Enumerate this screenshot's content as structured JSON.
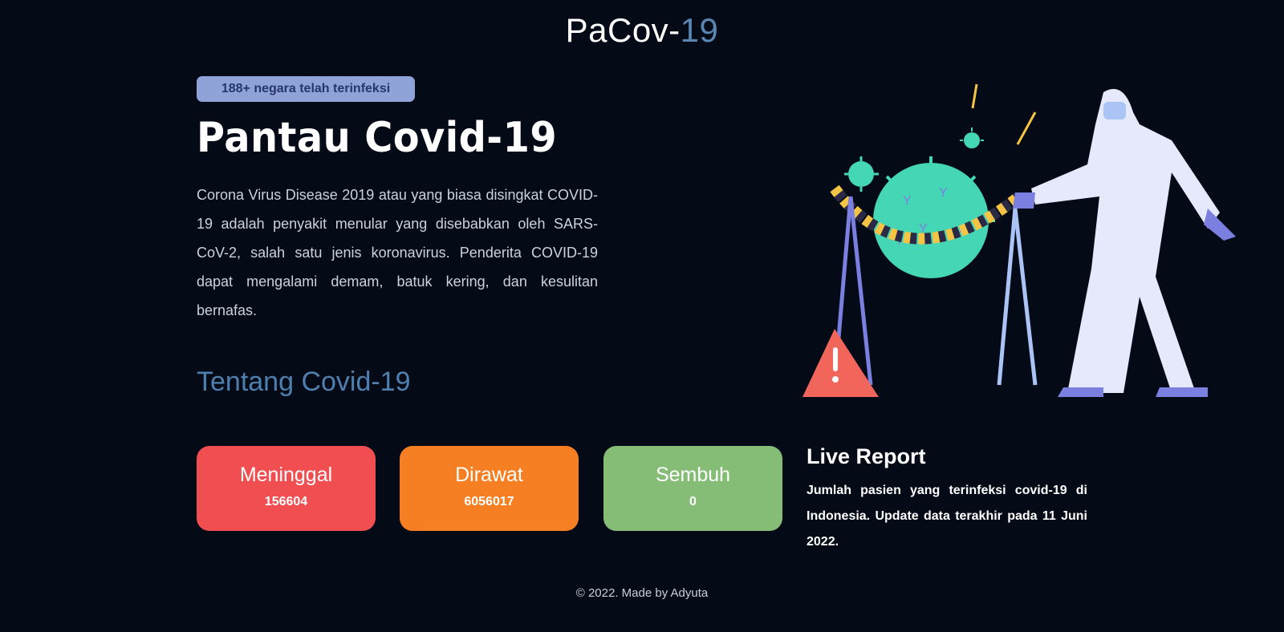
{
  "header": {
    "brand_main": "PaCov-",
    "brand_accent": "19"
  },
  "hero": {
    "badge": "188+ negara telah terinfeksi",
    "title": "Pantau Covid-19",
    "description": "Corona Virus Disease 2019 atau yang biasa disingkat COVID-19 adalah penyakit menular yang disebabkan oleh SARS-CoV-2, salah satu jenis koronavirus. Penderita COVID-19 dapat mengalami demam, batuk kering, dan kesulitan bernafas.",
    "about_link": "Tentang Covid-19"
  },
  "illustration": {
    "icon": "virus-hazmat-illustration"
  },
  "stats": [
    {
      "label": "Meninggal",
      "value": "156604",
      "color": "#f14e52"
    },
    {
      "label": "Dirawat",
      "value": "6056017",
      "color": "#f57f22"
    },
    {
      "label": "Sembuh",
      "value": "0",
      "color": "#86bd76"
    }
  ],
  "live_report": {
    "title": "Live Report",
    "description": "Jumlah pasien yang terinfeksi covid-19 di Indonesia. Update data terakhir pada 11 Juni 2022."
  },
  "footer": {
    "text": "© 2022. Made by Adyuta"
  },
  "colors": {
    "background": "#040b16",
    "accent": "#5b86b4",
    "badge": "#8fa3d9"
  }
}
